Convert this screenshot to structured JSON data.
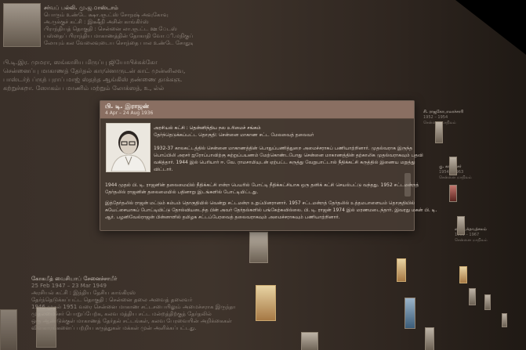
{
  "panel": {
    "name": "பி. டி. இராஜன்",
    "dates": "4 Apr – 24 Aug 1936",
    "meta_party": "அரசியல் கட்சி : தென்னிந்திய நல உரிமைச் சங்கம்",
    "meta_constituency": "தேர்ந்தெடுக்கப்பட்ட தொகுதி: சென்னை மாகாண சட்ட மேலவைத் தலைவர்",
    "bio_1": [
      "1932-37 காலகட்டத்தில் சென்னை மாகாணத்தின் பொதுப்பணித்துறை அமைச்சராகப் பணியாற்றினார். முதல்வராக இருந்த",
      "பொப்பிலி அரசர் ஐரோப்பாவிற்கு சுற்றுப்பயணம் மேற்கொண்டபோது சென்னை மாகாணத்தின் தற்காலிக முதல்வராகவும் பதவி",
      "வகித்தார். 1944 இல் பெரியார் ஈ. வே. ராமசாமியுடன் ஏற்பட்ட கருத்து வேறுபாட்டால் நீதிக்கட்சி கருத்தில் இணைய மறுத்து",
      "விட்டார்."
    ],
    "bio_2": [
      "1944 முதல் பி. டி. ராஜனின் தலைமையில் நீதிக்கட்சி என்ற பெயரில் போட்டி நீதிக்கட்சியாக ஒரு தனிக் கட்சி செயல்பட்டு வந்தது. 1952 சட்டமன்றத்",
      "தேர்தலில் ராஜனின் தலைமையில் பதினாறு இடங்களில் போட்டியிட்டது."
    ],
    "bio_3": [
      "இத்தேர்தலில் ராஜன் மட்டும் கம்பம் தொகுதியில் வென்று சட்டமன்ற உறுப்பினரானார். 1957 சட்டமன்றத் தேர்தலில் உத்தமபாளையம் தொகுதியில்",
      "சுயேட்சையாகப் போட்டியிட்டு தோல்வியடைந்த பின் அவர் தேர்தல்களில் பங்கேற்கவில்லை. பி. டி. ராஜன் 1974 இல் மரணமடைந்தார். இவரது மகன் பி. டி.",
      "ஆர். பழனிவேல்ராஜன் பின்னாளில் தமிழக சட்டப்பேரவைத் தலைவராகவும் அமைச்சராகவும் பணியாற்றினார்."
    ]
  },
  "wall_left_top": [
    "சர்வப் பல்லி. மு.ஜ.ாஸ்டாம்",
    "பொரும் உண்டே க்ஷா.ஞ.ட்ஸ் சோநஷ் அவுகோவு",
    "அ.ருக்குச் கட்சி : இக்ஷீநி அசின் காங்கிர்ஸ்",
    "பிராந்தியத் தொகுதி : சென்னை லா.ஞ.ட்ட ஊ.ேடஸ்",
    "பஸ்தைப் பிராந்திய மாகாணத்தின் தோகாதி வோ.ி.மநிகுப் பனாறு ஆகுஸன்னமான",
    "லோயும் கல வேலைவுடைய சொந்தை பால உண்டே சோதுடிய ஸ்தாயமு"
  ],
  "wall_left_mid": [
    "பி.டி.இர. முமரா, ஸங்காசிய மிருப்பு ஜியோபிச்சுக்கோ",
    "சென்னைப்பு மாகாணத் தேர்தல் காரனொருடன் காட் முன்னிலவ,",
    "பாஸ்டர்ந் ப்ருந் புராப் மாஜ் ஸ்தந்த ஆங்கிஸ் நண்ணை தாக்கஞ.",
    "கற்றுச்சுறா. ஸோகம்ப மாணிம் மற்றும் லோக்ஸத், உ, ல்ல்"
  ],
  "wall_bottom_left": [
    "கோகமீத் வைசியாப் சேனைச்சாமீர்",
    "25 Feb 1947 – 23 Mar 1949",
    "அரசியல் கட்சி : இந்திய தேசிய காங்கிரஸ்",
    "தேர்ந்தெடுக்கப்பட்ட தொகுதி : சென்னை தலை அவைத் தலைவர்",
    "1946 முதல் 1951 வரை சென்னை மாகாண சட்டசபையிலும் அமைச்சராக இருந்தார்.",
    "முதலமைச்சர் பொறுப்பேற்க, கலவ மத்திய சட்ட மன்றத்திற்குத் தேர்தலில்",
    "ஒரு ஆண்டுக்குள் மாகாணத் தேர்தல் சட்டங்கள், கலவ பேரவையின் அறிக்கைகள்",
    "விவகாரங்களைப் பற்றிய கருத்துகள் மக்கள் முன் அளிக்கப்பட்டது."
  ],
  "wall_right_cols": [
    [
      "சி. ராஜகோபாலாச்சாரி",
      "1952 – 1954",
      "சென்னை மாநிலம்"
    ],
    [
      "கு. காமராசர்",
      "1954 – 1963",
      "சென்னை மாநிலம்"
    ],
    [
      "எம். பக்தவத்சலம்",
      "1963 – 1967",
      "சென்னை மாநிலம்"
    ]
  ]
}
